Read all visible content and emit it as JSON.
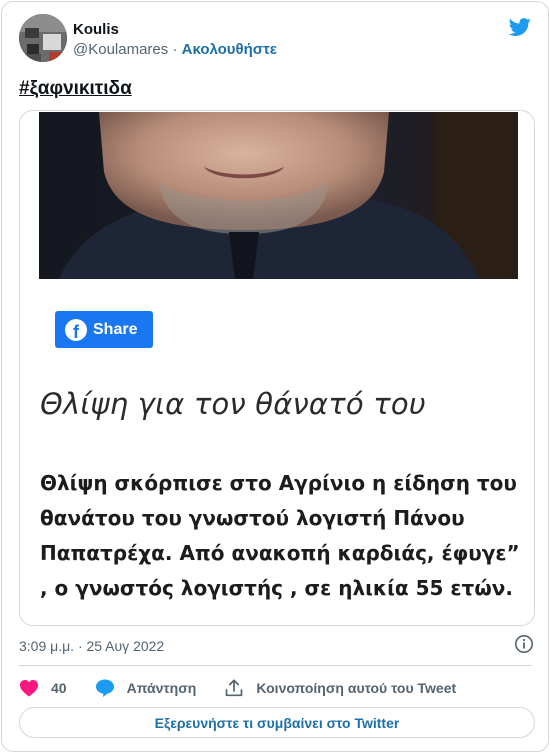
{
  "tweet": {
    "author_name": "Koulis",
    "author_handle": "@Koulamares",
    "separator": "·",
    "follow_label": "Ακολουθήστε",
    "hashtag": "#ξαφνικιτιδα",
    "timestamp": "3:09 μ.μ. · 25 Αυγ 2022",
    "likes_count": "40",
    "reply_label": "Απάντηση",
    "share_label": "Κοινοποίηση αυτού του Tweet",
    "explore_label": "Εξερευνήστε τι συμβαίνει στο Twitter"
  },
  "embedded_article": {
    "share_button_label": "Share",
    "title": "Θλίψη για τον θάνατό του",
    "body": "Θλίψη σκόρπισε στο Αγρίνιο η είδηση του θανάτου του γνωστού λογιστή Πάνου Παπατρέχα. Από ανακοπή καρδιάς, έφυγε” , ο γνωστός λογιστής , σε ηλικία 55 ετών."
  },
  "icons": {
    "brand": "twitter-bird-icon",
    "facebook": "facebook-icon",
    "info": "info-icon",
    "like": "heart-icon",
    "reply": "speech-bubble-icon",
    "share": "share-upload-icon"
  },
  "colors": {
    "twitter_blue": "#1d9bf0",
    "link_blue": "#1d6fa5",
    "facebook_blue": "#1a77f2",
    "like_pink": "#f91880",
    "muted_text": "#536471",
    "border": "#cfd9de"
  }
}
